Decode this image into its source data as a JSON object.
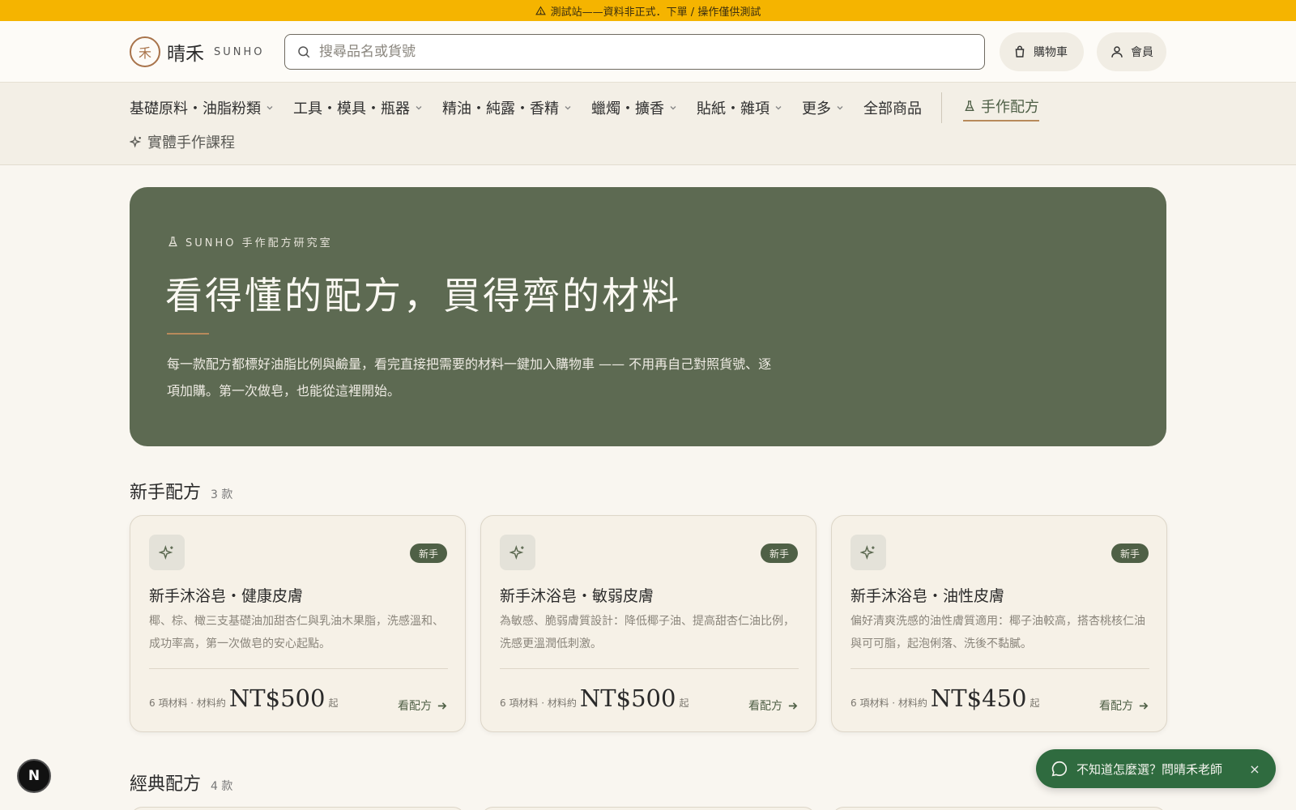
{
  "banner": {
    "text": "測試站——資料非正式．下單 / 操作僅供測試"
  },
  "header": {
    "logo_mark": "禾",
    "logo_cn": "晴禾",
    "logo_en": "SUNHO",
    "search_placeholder": "搜尋品名或貨號",
    "cart_label": "購物車",
    "member_label": "會員"
  },
  "nav": {
    "items": [
      {
        "label": "基礎原料・油脂粉類",
        "dropdown": true
      },
      {
        "label": "工具・模具・瓶器",
        "dropdown": true
      },
      {
        "label": "精油・純露・香精",
        "dropdown": true
      },
      {
        "label": "蠟燭・擴香",
        "dropdown": true
      },
      {
        "label": "貼紙・雜項",
        "dropdown": true
      },
      {
        "label": "更多",
        "dropdown": true
      },
      {
        "label": "全部商品",
        "dropdown": false
      }
    ],
    "active_label": "手作配方",
    "courses_label": "實體手作課程"
  },
  "hero": {
    "eyebrow": "SUNHO 手作配方研究室",
    "title": "看得懂的配方，買得齊的材料",
    "desc": "每一款配方都標好油脂比例與鹼量，看完直接把需要的材料一鍵加入購物車 —— 不用再自己對照貨號、逐項加購。第一次做皂，也能從這裡開始。"
  },
  "sections": [
    {
      "title": "新手配方",
      "count": "3 款",
      "cards": [
        {
          "badge": "新手",
          "title": "新手沐浴皂・健康皮膚",
          "desc": "椰、棕、橄三支基礎油加甜杏仁與乳油木果脂，洗感溫和、成功率高，第一次做皂的安心起點。",
          "meta": "6 項材料 · 材料約",
          "price": "NT$500",
          "suffix": "起",
          "link": "看配方"
        },
        {
          "badge": "新手",
          "title": "新手沐浴皂・敏弱皮膚",
          "desc": "為敏感、脆弱膚質設計：降低椰子油、提高甜杏仁油比例，洗感更溫潤低刺激。",
          "meta": "6 項材料 · 材料約",
          "price": "NT$500",
          "suffix": "起",
          "link": "看配方"
        },
        {
          "badge": "新手",
          "title": "新手沐浴皂・油性皮膚",
          "desc": "偏好清爽洗感的油性膚質適用：椰子油較高，搭杏桃核仁油與可可脂，起泡俐落、洗後不黏膩。",
          "meta": "6 項材料 · 材料約",
          "price": "NT$450",
          "suffix": "起",
          "link": "看配方"
        }
      ]
    },
    {
      "title": "經典配方",
      "count": "4 款"
    }
  ],
  "floating": {
    "ask_label": "不知道怎麼選？問晴禾老師",
    "close_glyph": "×",
    "next_badge": "N"
  },
  "colors": {
    "banner": "#f5b400",
    "hero": "#5d6a52",
    "accent": "#4f6046",
    "ask": "#2f6b3f"
  }
}
